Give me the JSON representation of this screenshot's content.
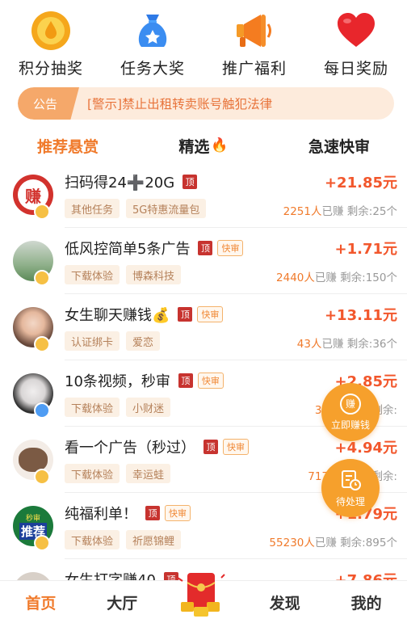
{
  "quick": [
    {
      "label": "积分抽奖",
      "icon": "coin-drop-icon"
    },
    {
      "label": "任务大奖",
      "icon": "money-bag-icon"
    },
    {
      "label": "推广福利",
      "icon": "megaphone-icon"
    },
    {
      "label": "每日奖励",
      "icon": "heart-icon"
    }
  ],
  "notice": {
    "tag": "公告",
    "text": "[警示]禁止出租转卖账号触犯法律"
  },
  "tabs": [
    {
      "label": "推荐悬赏",
      "active": true
    },
    {
      "label": "精选",
      "active": false
    },
    {
      "label": "急速快审",
      "active": false
    }
  ],
  "tasks": [
    {
      "title": "扫码得24➕20G",
      "ding": "顶",
      "fast": "",
      "reward": "+21.85元",
      "tags": [
        "其他任务",
        "5G特惠流量包"
      ],
      "earned": "2251人",
      "earned_suffix": "已赚",
      "remaining": "剩余:25个"
    },
    {
      "title": "低风控简单5条广告",
      "ding": "顶",
      "fast": "快审",
      "reward": "+1.71元",
      "tags": [
        "下载体验",
        "博森科技"
      ],
      "earned": "2440人",
      "earned_suffix": "已赚",
      "remaining": "剩余:150个"
    },
    {
      "title": "女生聊天赚钱💰",
      "ding": "顶",
      "fast": "快审",
      "reward": "+13.11元",
      "tags": [
        "认证绑卡",
        "爱恋"
      ],
      "earned": "43人",
      "earned_suffix": "已赚",
      "remaining": "剩余:36个"
    },
    {
      "title": "10条视频，秒审",
      "ding": "顶",
      "fast": "快审",
      "reward": "+2.85元",
      "tags": [
        "下载体验",
        "小财迷"
      ],
      "earned": "349人",
      "earned_suffix": "已赚",
      "remaining": "剩余:"
    },
    {
      "title": "看一个广告（秒过）",
      "ding": "顶",
      "fast": "快审",
      "reward": "+4.94元",
      "tags": [
        "下载体验",
        "幸运蛙"
      ],
      "earned": "7177人",
      "earned_suffix": "已赚",
      "remaining": "剩余:"
    },
    {
      "title": "纯福利单！",
      "ding": "顶",
      "fast": "快审",
      "reward": "+1.79元",
      "tags": [
        "下载体验",
        "祈愿锦鲤"
      ],
      "earned": "55230人",
      "earned_suffix": "已赚",
      "remaining": "剩余:895个"
    },
    {
      "title": "女生打字赚40",
      "ding": "顶",
      "fast": "",
      "reward": "+7.86元",
      "tags": [],
      "earned": "",
      "earned_suffix": "",
      "remaining": ""
    }
  ],
  "float_earn": {
    "label": "立即赚钱",
    "icon_text": "赚"
  },
  "float_pending": {
    "label": "待处理"
  },
  "nav": [
    {
      "label": "首页",
      "active": true
    },
    {
      "label": "大厅",
      "active": false
    },
    {
      "label": "发现",
      "active": false
    },
    {
      "label": "我的",
      "active": false
    }
  ],
  "avatar_badge_text": "推荐",
  "avatar_zhuan_text": "赚",
  "avatar_miaoshen_text": "秒审",
  "colors": {
    "accent": "#f07a2b",
    "reward": "#f2572c",
    "float": "#f6a02c"
  }
}
